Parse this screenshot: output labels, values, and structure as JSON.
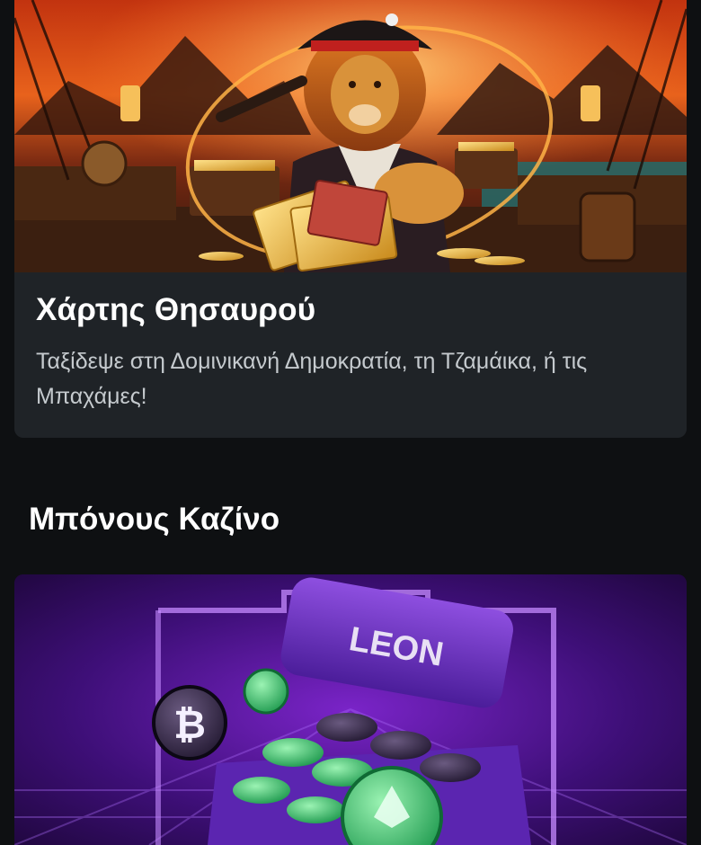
{
  "promo": {
    "title": "Χάρτης Θησαυρού",
    "description": "Ταξίδεψε στη Δομινικανή Δημοκρατία, τη Τζαμάικα, ή τις Μπαχάμες!",
    "banner_icon": "pirate-lion-treasure-illustration"
  },
  "casino_bonus": {
    "section_title": "Μπόνους Καζίνο",
    "banner_logo_text": "LEON",
    "banner_icon": "crypto-treasure-chest-illustration"
  },
  "colors": {
    "page_bg": "#0e1012",
    "card_bg": "#1f2327",
    "bonus_purple": "#6a1fb0"
  }
}
